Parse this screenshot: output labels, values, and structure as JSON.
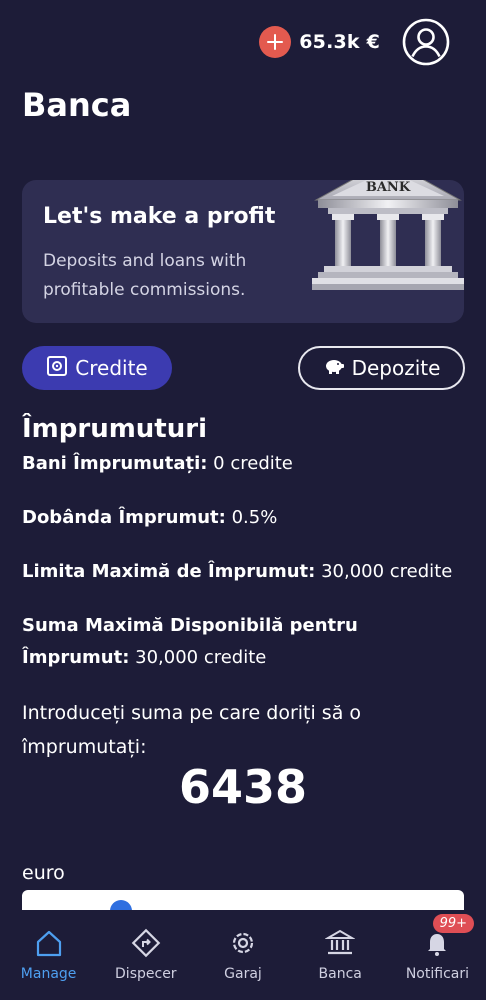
{
  "header": {
    "balance": "65.3k €",
    "add_icon": "plus-icon",
    "profile_icon": "user-icon"
  },
  "page_title": "Banca",
  "banner": {
    "title": "Let's make a profit",
    "subtitle": "Deposits and loans with profitable commissions.",
    "illustration_sign": "BANK"
  },
  "tabs": [
    {
      "label": "Credite",
      "icon": "safe-icon",
      "active": true
    },
    {
      "label": "Depozite",
      "icon": "piggy-bank-icon",
      "active": false
    }
  ],
  "section": {
    "title": "Împrumuturi",
    "borrowed_label": "Bani Împrumutați:",
    "borrowed_value": " 0 credite",
    "interest_label": "Dobânda Împrumut:",
    "interest_value": " 0.5%",
    "limit_label": "Limita Maximă de Împrumut:",
    "limit_value": " 30,000 credite",
    "available_label": "Suma Maximă Disponibilă pentru Împrumut:",
    "available_value": " 30,000 credite",
    "prompt": "Introduceți suma pe care doriți să o împrumutați:",
    "amount": "6438",
    "currency": "euro",
    "slider_fraction": 0.21
  },
  "nav": [
    {
      "label": "Manage",
      "icon": "home-icon",
      "active": true
    },
    {
      "label": "Dispecer",
      "icon": "directions-icon",
      "active": false
    },
    {
      "label": "Garaj",
      "icon": "gear-icon",
      "active": false
    },
    {
      "label": "Banca",
      "icon": "bank-icon",
      "active": false
    },
    {
      "label": "Notificari",
      "icon": "bell-icon",
      "active": false,
      "badge": "99+"
    }
  ],
  "colors": {
    "background": "#1d1c38",
    "card": "#2f2e52",
    "accent_tab": "#3c3bb0",
    "active_nav": "#4e9ff0",
    "badge": "#df4e55",
    "coin_button": "#e35a4f"
  }
}
